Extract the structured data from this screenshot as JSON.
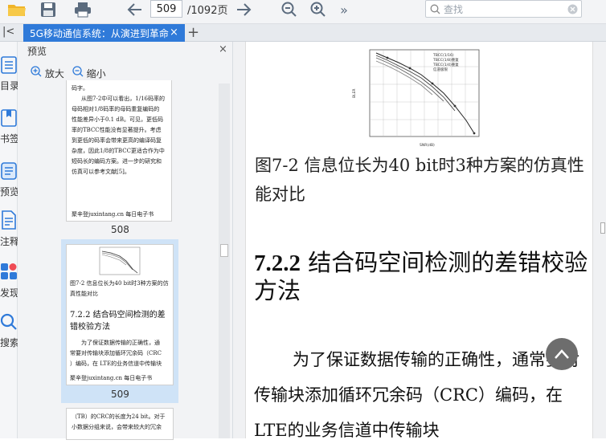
{
  "toolbar": {
    "page_input": "509",
    "page_total": "/1092页",
    "search_placeholder": "查找",
    "more": "»"
  },
  "tabs": {
    "active_title": "5G移动通信系统：从演进到革命",
    "close": "×",
    "add": "+",
    "collapse": "|<"
  },
  "rail": {
    "items": [
      {
        "label": "目录",
        "icon": "toc-icon"
      },
      {
        "label": "书签",
        "icon": "bookmark-icon"
      },
      {
        "label": "预览",
        "icon": "preview-icon"
      },
      {
        "label": "注释",
        "icon": "annotation-icon"
      },
      {
        "label": "发现",
        "icon": "discover-icon"
      },
      {
        "label": "搜索",
        "icon": "search-icon"
      }
    ]
  },
  "panel": {
    "title": "预览",
    "zoom_in": "放大",
    "zoom_out": "缩小",
    "thumbs": [
      {
        "lines": [
          "码字。",
          "从图7-2中可以看出，1/16码率的",
          "母码相对1/8码率的母码重复编码的",
          "性能差异小于0.1 dB。可见，更低码",
          "率的TBCC性能没有显著提升。考虑",
          "到更低的码率会带来更高的编译码复",
          "杂度，因此1/8的TBCC更适合作为中",
          "短码长的编码方案。进一步的研究和",
          "仿真可以参考文献[5]。"
        ],
        "footer": "聚辛登juxintang.cn 每日电子书",
        "page": "508"
      },
      {
        "caption": "图7-2  信息位长为40  bit时3种方案的仿真性能对比",
        "heading": "7.2.2 结合码空间检测的差错校验方法",
        "lines": [
          "为了保证数据传输的正确性，通",
          "常要对传输块添加循环冗余码（CRC",
          "）编码，在 LTE的业务信道中传输块"
        ],
        "footer": "聚辛登juxintang.cn 每日电子书",
        "page": "509"
      },
      {
        "lines": [
          "（TB）的CRC的长度为24  bit。对于",
          "小数据分组来说，会带来较大的冗余"
        ]
      }
    ]
  },
  "main": {
    "figure_legend": [
      "TBCC(1/16)",
      "TBCC(1/8)重复",
      "TBCC(1/4)重复",
      "信道极限"
    ],
    "figure_xlabel": "SNR(dB)",
    "figure_ylabel": "BLER",
    "caption": "图7-2  信息位长为40  bit时3种方案的仿真性能对比",
    "section_number": "7.2.2",
    "section_title": " 结合码空间检测的差错校验方法",
    "paragraph": "为了保证数据传输的正确性，通常要对传输块添加循环冗余码（CRC）编码，在 LTE的业务信道中传输块"
  }
}
